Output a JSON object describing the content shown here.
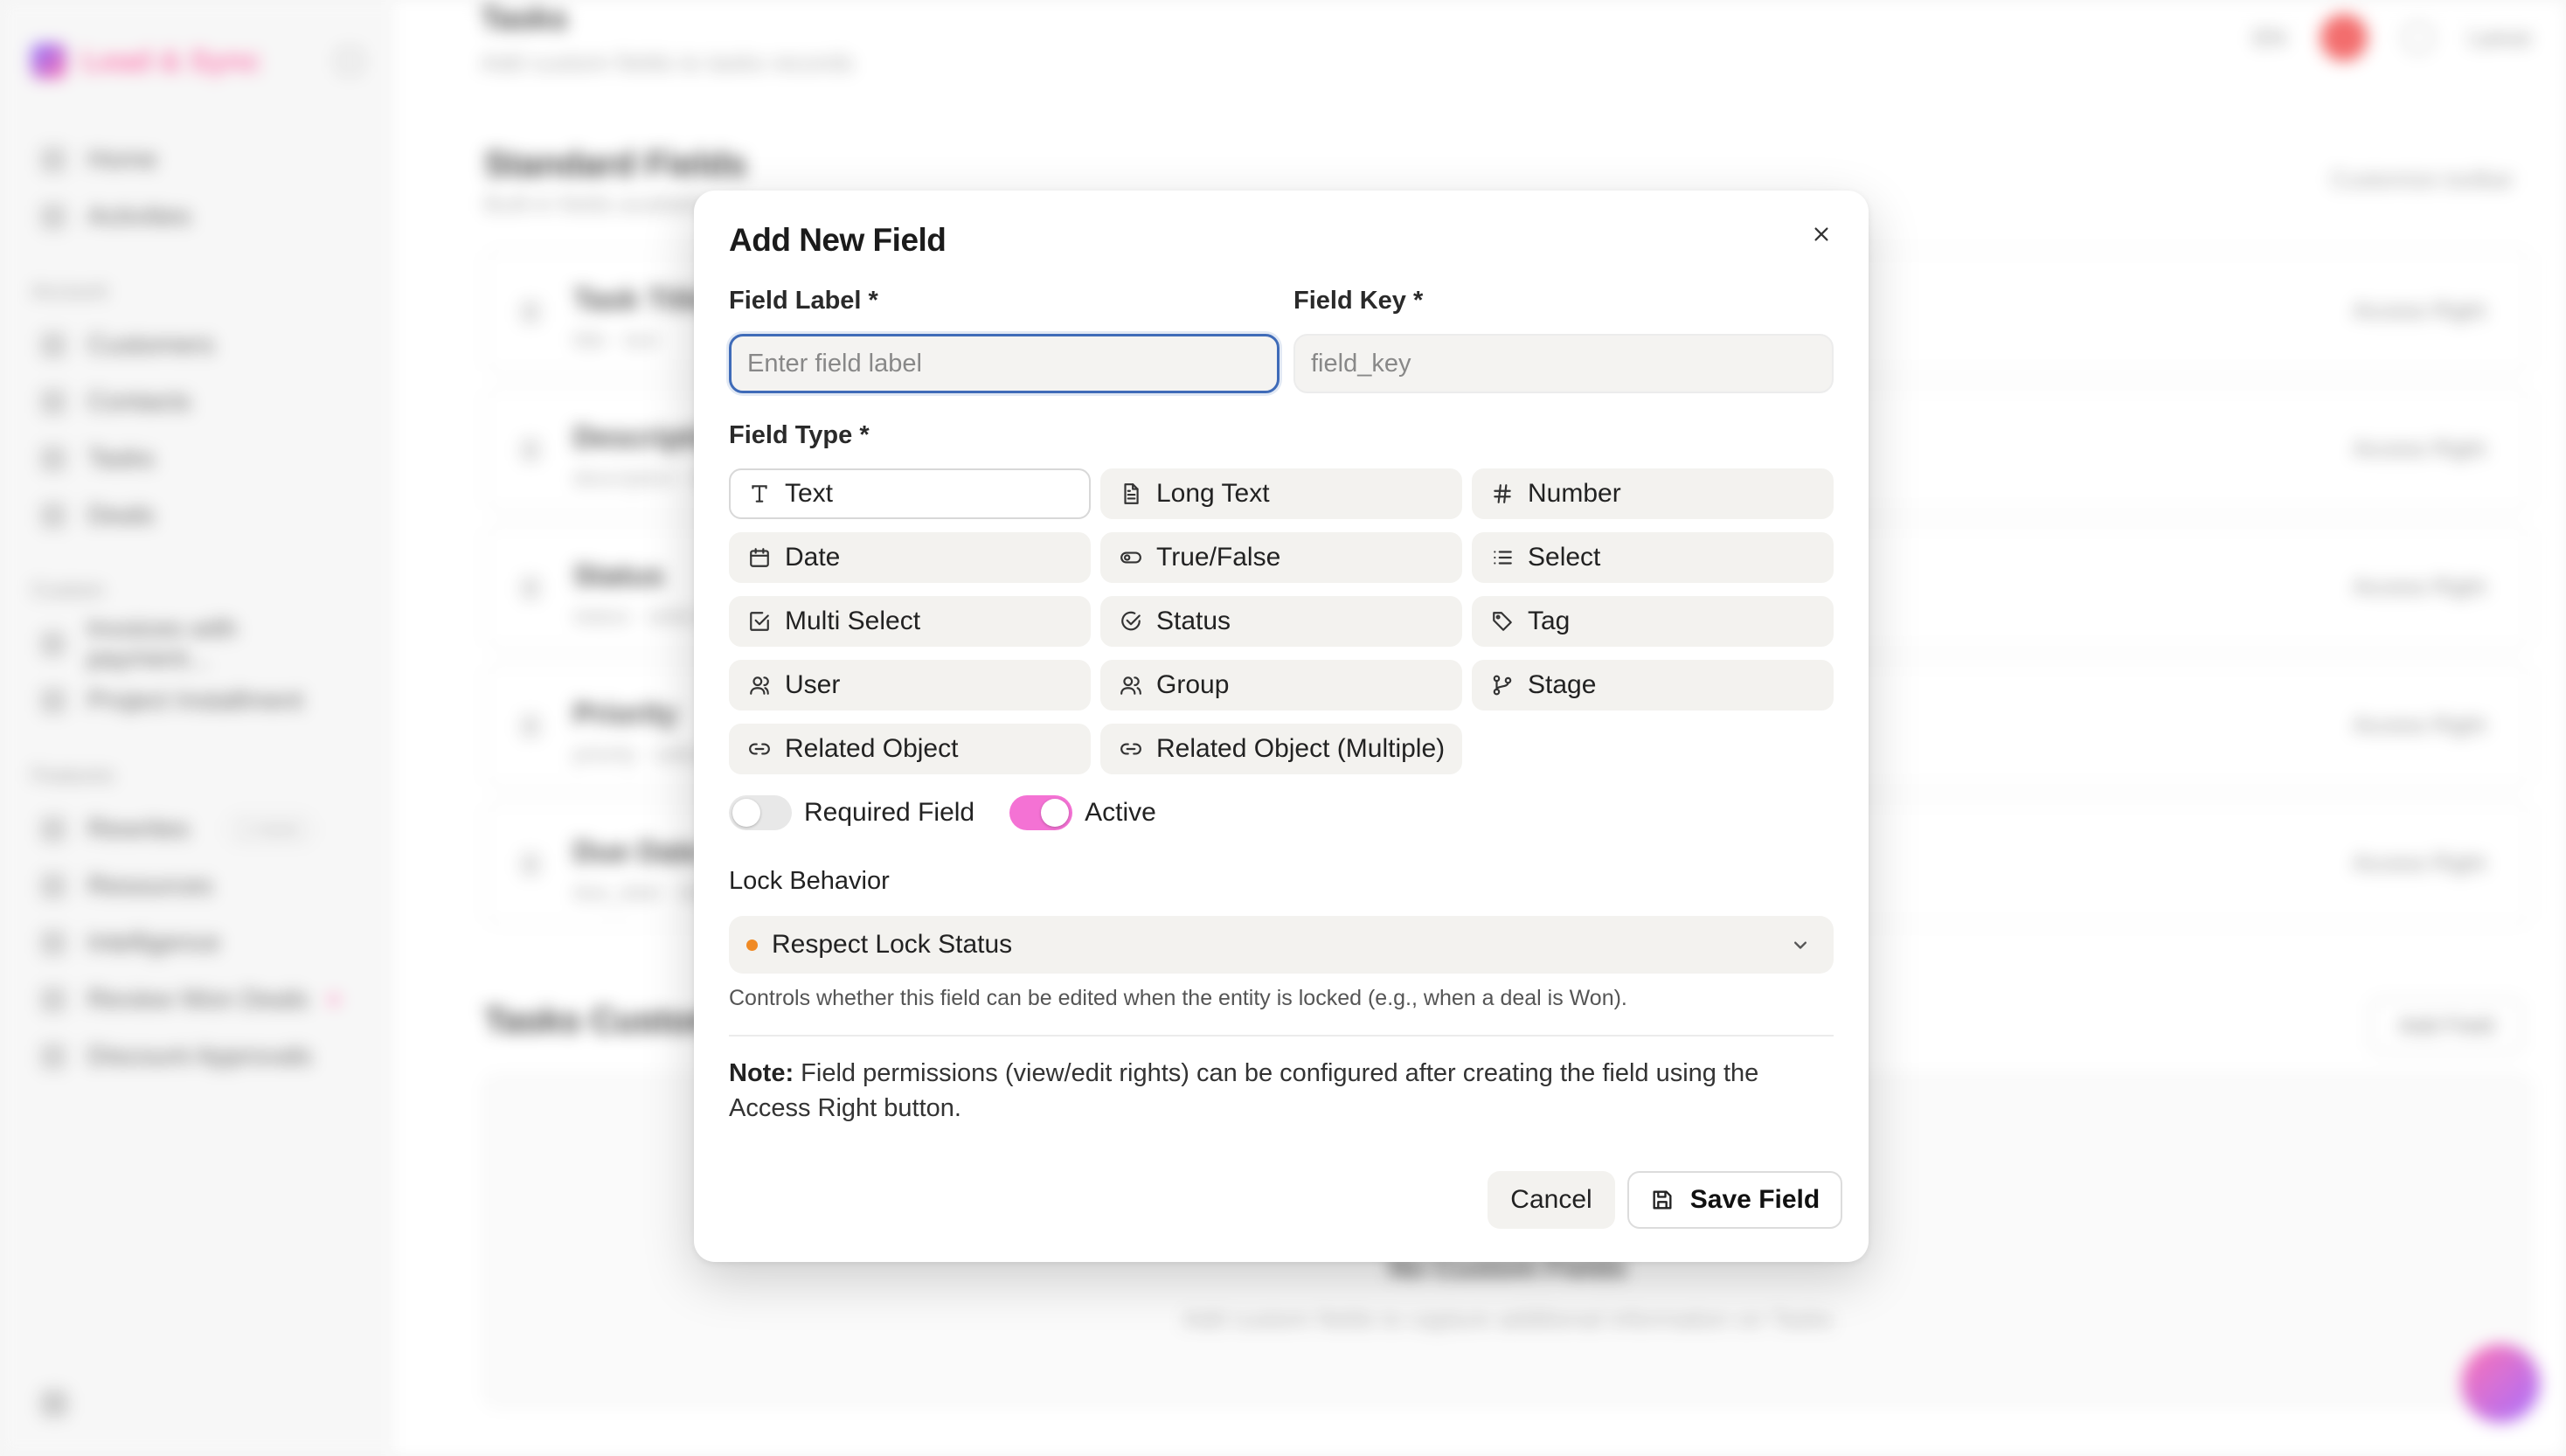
{
  "background": {
    "brand_name": "Lead & Sync",
    "sidebar": {
      "top_items": [
        "Home",
        "Activities"
      ],
      "section1": "Account",
      "section1_items": [
        "Customers",
        "Contacts",
        "Tasks",
        "Deals"
      ],
      "section2": "Custom",
      "section2_items": [
        "Invoices with payment...",
        "Project Installment"
      ],
      "section3": "Features",
      "section3_items": [
        "Rewrites",
        "Resources",
        "Intelligence",
        "Review Won Deals",
        "Discount Approvals"
      ],
      "rewrites_tag": "1 more"
    },
    "page_title": "Tasks",
    "page_subtitle": "Add custom fields to tasks records",
    "top_badge": "EN",
    "top_user": "Lance",
    "standard_title": "Standard Fields",
    "standard_sub": "Built-in fields available",
    "standard_link": "Customize toolbar",
    "rows": [
      {
        "name": "Task Title",
        "meta": "title · text"
      },
      {
        "name": "Description",
        "meta": "description · text"
      },
      {
        "name": "Status",
        "meta": "status · select"
      },
      {
        "name": "Priority",
        "meta": "priority · select"
      },
      {
        "name": "Due Date",
        "meta": "due_date · date"
      }
    ],
    "access_label": "Access Right",
    "custom_title": "Tasks Custom Fields",
    "custom_btn": "Add Field",
    "empty_title": "No Custom Fields",
    "empty_sub": "Add custom fields to capture additional information on Tasks"
  },
  "modal": {
    "title": "Add New Field",
    "field_label": {
      "label": "Field Label *",
      "placeholder": "Enter field label",
      "value": ""
    },
    "field_key": {
      "label": "Field Key *",
      "placeholder": "field_key",
      "value": ""
    },
    "field_type_label": "Field Type *",
    "field_types": [
      {
        "label": "Text",
        "icon": "text-icon",
        "selected": true
      },
      {
        "label": "Long Text",
        "icon": "document-icon",
        "selected": false
      },
      {
        "label": "Number",
        "icon": "hash-icon",
        "selected": false
      },
      {
        "label": "Date",
        "icon": "calendar-icon",
        "selected": false
      },
      {
        "label": "True/False",
        "icon": "toggle-icon",
        "selected": false
      },
      {
        "label": "Select",
        "icon": "list-icon",
        "selected": false
      },
      {
        "label": "Multi Select",
        "icon": "checkbox-icon",
        "selected": false
      },
      {
        "label": "Status",
        "icon": "check-circle-icon",
        "selected": false
      },
      {
        "label": "Tag",
        "icon": "tag-icon",
        "selected": false
      },
      {
        "label": "User",
        "icon": "user-icon",
        "selected": false
      },
      {
        "label": "Group",
        "icon": "users-icon",
        "selected": false
      },
      {
        "label": "Stage",
        "icon": "branch-icon",
        "selected": false
      },
      {
        "label": "Related Object",
        "icon": "link-icon",
        "selected": false
      },
      {
        "label": "Related Object (Multiple)",
        "icon": "link-icon",
        "selected": false
      }
    ],
    "required_label": "Required Field",
    "required_on": false,
    "active_label": "Active",
    "active_on": true,
    "lock_behavior_label": "Lock Behavior",
    "lock_behavior_value": "Respect Lock Status",
    "lock_dot_color": "#f08a24",
    "help_text": "Controls whether this field can be edited when the entity is locked (e.g., when a deal is Won).",
    "note_bold": "Note:",
    "note_text": " Field permissions (view/edit rights) can be configured after creating the field using the Access Right button.",
    "cancel_label": "Cancel",
    "save_label": "Save Field",
    "accent_color": "#f472d4",
    "focus_color": "#3f6bb8"
  }
}
